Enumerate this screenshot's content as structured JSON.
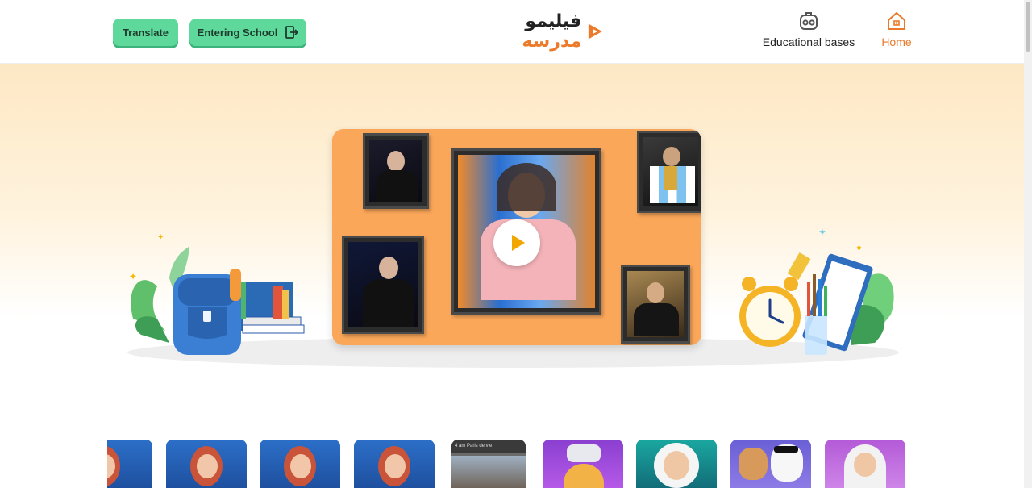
{
  "header": {
    "translate_label": "Translate",
    "entering_school_label": "Entering School",
    "logo_text_dark": "فیلیمو",
    "logo_text_orange": "مدرسه",
    "nav": [
      {
        "label": "Educational bases",
        "icon": "robot-icon"
      },
      {
        "label": "Home",
        "icon": "home-icon",
        "active": true
      }
    ]
  },
  "colors": {
    "accent_green": "#5ed99b",
    "accent_orange": "#e9792b",
    "hero_top": "#fde8c4",
    "video_card_bg": "#fba75a"
  },
  "hero": {
    "video_thumbnail": "collage of framed portraits with play button",
    "play_icon": "play-icon"
  },
  "thumbnails": [
    {
      "name": "thumb-surprised-woman-1"
    },
    {
      "name": "thumb-surprised-woman-2"
    },
    {
      "name": "thumb-surprised-woman-3"
    },
    {
      "name": "thumb-surprised-woman-4"
    },
    {
      "name": "thumb-paris-video",
      "caption": "4 am Paris de vie"
    },
    {
      "name": "thumb-vr-child"
    },
    {
      "name": "thumb-astronaut-girl"
    },
    {
      "name": "thumb-cat-and-dog"
    },
    {
      "name": "thumb-hijab-girl"
    }
  ]
}
